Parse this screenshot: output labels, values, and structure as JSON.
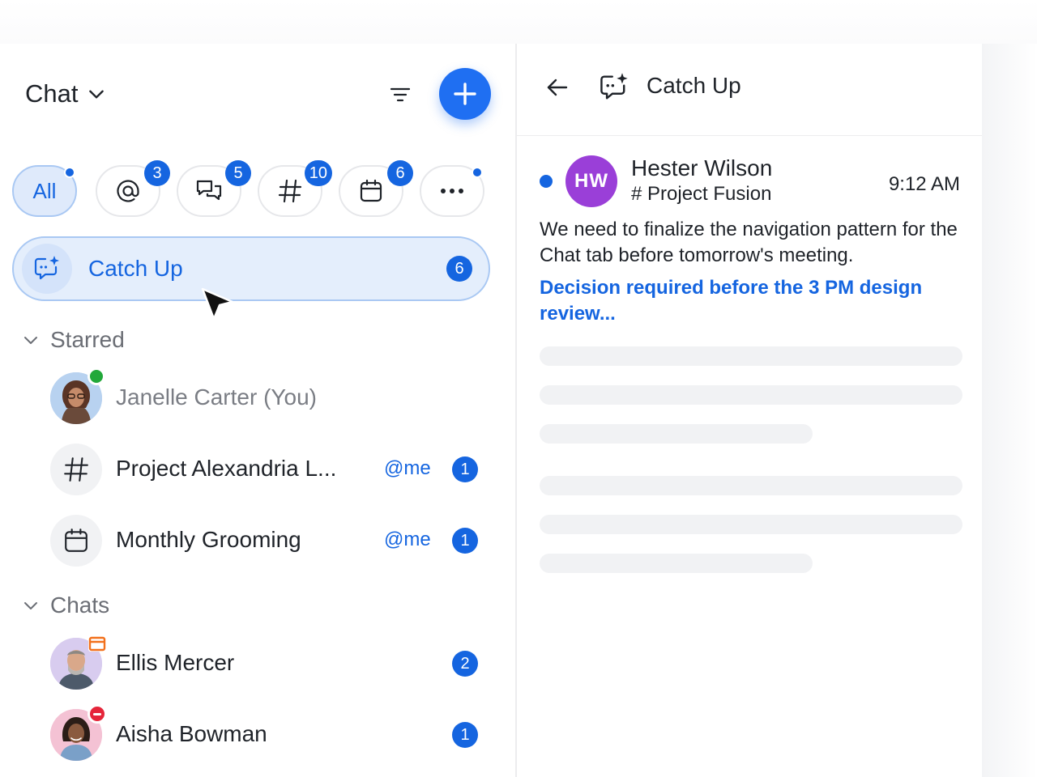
{
  "left_panel": {
    "title": "Chat",
    "filters": [
      {
        "label": "All",
        "badge": "",
        "dot": true,
        "icon": "",
        "active": true
      },
      {
        "label": "",
        "badge": "3",
        "dot": false,
        "icon": "at-icon",
        "active": false
      },
      {
        "label": "",
        "badge": "5",
        "dot": false,
        "icon": "threads-icon",
        "active": false
      },
      {
        "label": "",
        "badge": "10",
        "dot": false,
        "icon": "hash-icon",
        "active": false
      },
      {
        "label": "",
        "badge": "6",
        "dot": false,
        "icon": "calendar-icon",
        "active": false
      },
      {
        "label": "",
        "badge": "",
        "dot": true,
        "icon": "more-icon",
        "active": false
      }
    ],
    "catch_up": {
      "label": "Catch Up",
      "count": "6"
    },
    "starred": {
      "title": "Starred",
      "items": [
        {
          "name": "Janelle Carter (You)",
          "mention": "",
          "count": "",
          "presence": "online"
        },
        {
          "name": "Project Alexandria L...",
          "mention": "@me",
          "count": "1",
          "icon": "hash-icon"
        },
        {
          "name": "Monthly Grooming",
          "mention": "@me",
          "count": "1",
          "icon": "calendar-icon"
        }
      ]
    },
    "chats": {
      "title": "Chats",
      "items": [
        {
          "name": "Ellis Mercer",
          "count": "2",
          "status": "in-meeting"
        },
        {
          "name": "Aisha Bowman",
          "count": "1",
          "status": "do-not-disturb"
        }
      ]
    }
  },
  "right_panel": {
    "title": "Catch Up",
    "message": {
      "initials": "HW",
      "sender": "Hester Wilson",
      "channel": "# Project Fusion",
      "time": "9:12 AM",
      "text": "We need to finalize the navigation pattern for the Chat tab before tomorrow's meeting.",
      "summary": "Decision required before the 3 PM design review..."
    }
  },
  "colors": {
    "accent": "#1565e0",
    "accent_light": "#e4eefc",
    "avatar_purple": "#9a3fd8",
    "online": "#22a83a",
    "dnd": "#e5253a",
    "meeting": "#f2711c"
  }
}
